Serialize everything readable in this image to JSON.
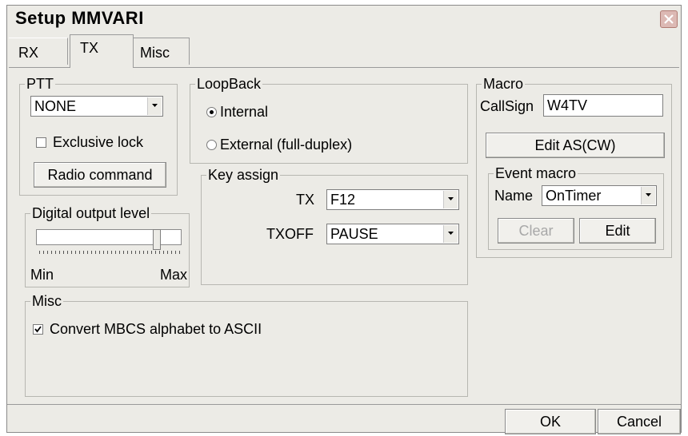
{
  "window": {
    "title": "Setup MMVARI"
  },
  "tabs": [
    {
      "label": "RX",
      "active": false
    },
    {
      "label": "TX",
      "active": true
    },
    {
      "label": "Misc",
      "active": false
    }
  ],
  "ptt": {
    "group_label": "PTT",
    "selected": "NONE",
    "exclusive_lock": {
      "label": "Exclusive lock",
      "checked": false
    },
    "radio_command_label": "Radio command"
  },
  "digital_output": {
    "group_label": "Digital output level",
    "min_label": "Min",
    "max_label": "Max",
    "level": 0.85
  },
  "loopback": {
    "group_label": "LoopBack",
    "options": [
      {
        "label": "Internal",
        "selected": true
      },
      {
        "label": "External (full-duplex)",
        "selected": false
      }
    ]
  },
  "key_assign": {
    "group_label": "Key assign",
    "tx_label": "TX",
    "tx_value": "F12",
    "txoff_label": "TXOFF",
    "txoff_value": "PAUSE"
  },
  "macro": {
    "group_label": "Macro",
    "callsign_label": "CallSign",
    "callsign_value": "W4TV",
    "edit_as_label": "Edit AS(CW)",
    "event_macro": {
      "group_label": "Event macro",
      "name_label": "Name",
      "name_value": "OnTimer",
      "clear_label": "Clear",
      "edit_label": "Edit"
    }
  },
  "misc": {
    "group_label": "Misc",
    "convert": {
      "label": "Convert MBCS alphabet to ASCII",
      "checked": true
    }
  },
  "footer": {
    "ok_label": "OK",
    "cancel_label": "Cancel"
  }
}
